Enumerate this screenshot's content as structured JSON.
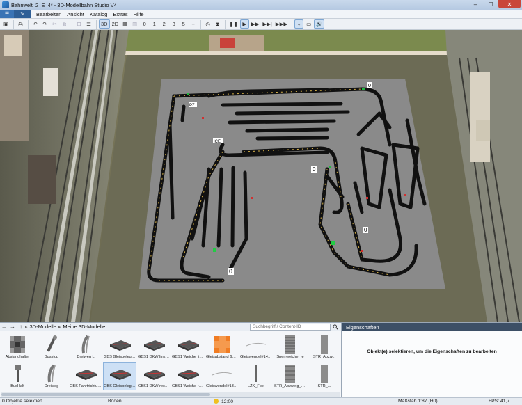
{
  "window": {
    "title": "Bahnwelt_2_E_4* - 3D-Modellbahn Studio V4",
    "minimize": "–",
    "maximize": "☐",
    "close": "✕"
  },
  "menu": {
    "home_icon": "☰",
    "edit_icon": "✎",
    "items": [
      "Bearbeiten",
      "Ansicht",
      "Katalog",
      "Extras",
      "Hilfe"
    ]
  },
  "toolbar": {
    "save": "▣",
    "print": "⎙",
    "undo": "↶",
    "redo": "↷",
    "cut": "✂",
    "copy": "⧉",
    "align": "⊡",
    "list": "☰",
    "view_3d": "3D",
    "view_2d": "2D",
    "grid": "▦",
    "layers": "▥",
    "speed_0": "0",
    "speed_1": "1",
    "speed_2": "2",
    "speed_3": "3",
    "speed_5": "5",
    "add": "+",
    "clock": "◷",
    "timer": "⧗",
    "pause": "❚❚",
    "play": "▶",
    "fast": "▶▶",
    "faster": "▶▶|",
    "fastest": "▶▶▶",
    "download": "⤓",
    "panel": "▭",
    "sound": "🔊"
  },
  "layout_labels": {
    "pz": "PZ",
    "ice": "ICE",
    "zero_1": "0",
    "zero_2": "0",
    "zero_3": "0",
    "zero_4": "0"
  },
  "catalog": {
    "back": "←",
    "forward": "→",
    "up": "↑",
    "breadcrumb": [
      "3D-Modelle",
      "Meine 3D-Modelle"
    ],
    "search_placeholder": "Suchbegriff / Content-ID",
    "items": [
      {
        "label": "Abstandhalter",
        "icon": "grid-block-icon"
      },
      {
        "label": "Busstop",
        "icon": "busstop-icon"
      },
      {
        "label": "Dreiweg L",
        "icon": "curve-track-icon"
      },
      {
        "label": "GBS Gleisbelegu...",
        "icon": "gbs-plate-icon"
      },
      {
        "label": "GBS1 DKW links ...",
        "icon": "gbs-plate-icon"
      },
      {
        "label": "GBS1 Weiche lin...",
        "icon": "gbs-plate-icon"
      },
      {
        "label": "Gleisabstand 61,88",
        "icon": "orange-cross-icon"
      },
      {
        "label": "Gleiswendel#143...",
        "icon": "helix-icon"
      },
      {
        "label": "Sperrweiche_re",
        "icon": "track-piece-icon"
      },
      {
        "label": "STR_Abzw...",
        "icon": "track-piece-icon"
      },
      {
        "label": "BusHalt",
        "icon": "bus-stop-pole-icon"
      },
      {
        "label": "Dreiweg",
        "icon": "curve-track-icon"
      },
      {
        "label": "GBS Fahrtrichtung",
        "icon": "gbs-plate-icon"
      },
      {
        "label": "GBS Gleisbelegu...",
        "icon": "gbs-plate-icon"
      },
      {
        "label": "GBS1 DKW recht...",
        "icon": "gbs-plate-icon"
      },
      {
        "label": "GBS1 Weiche rech...",
        "icon": "gbs-plate-icon"
      },
      {
        "label": "Gleiswendel#133...",
        "icon": "helix-icon"
      },
      {
        "label": "LZK_Flex",
        "icon": "pole-icon"
      },
      {
        "label": "STR_Abzweig_Li...",
        "icon": "track-piece-icon"
      },
      {
        "label": "STR_...",
        "icon": "track-piece-icon"
      }
    ]
  },
  "properties": {
    "header": "Eigenschaften",
    "message": "Objekt(e) selektieren, um die Eigenschaften zu bearbeiten"
  },
  "status": {
    "selection": "0 Objekte selektiert",
    "ground": "Boden",
    "time": "12:00",
    "scale": "Maßstab 1:87 (H0)",
    "fps": "FPS: 41,7"
  }
}
